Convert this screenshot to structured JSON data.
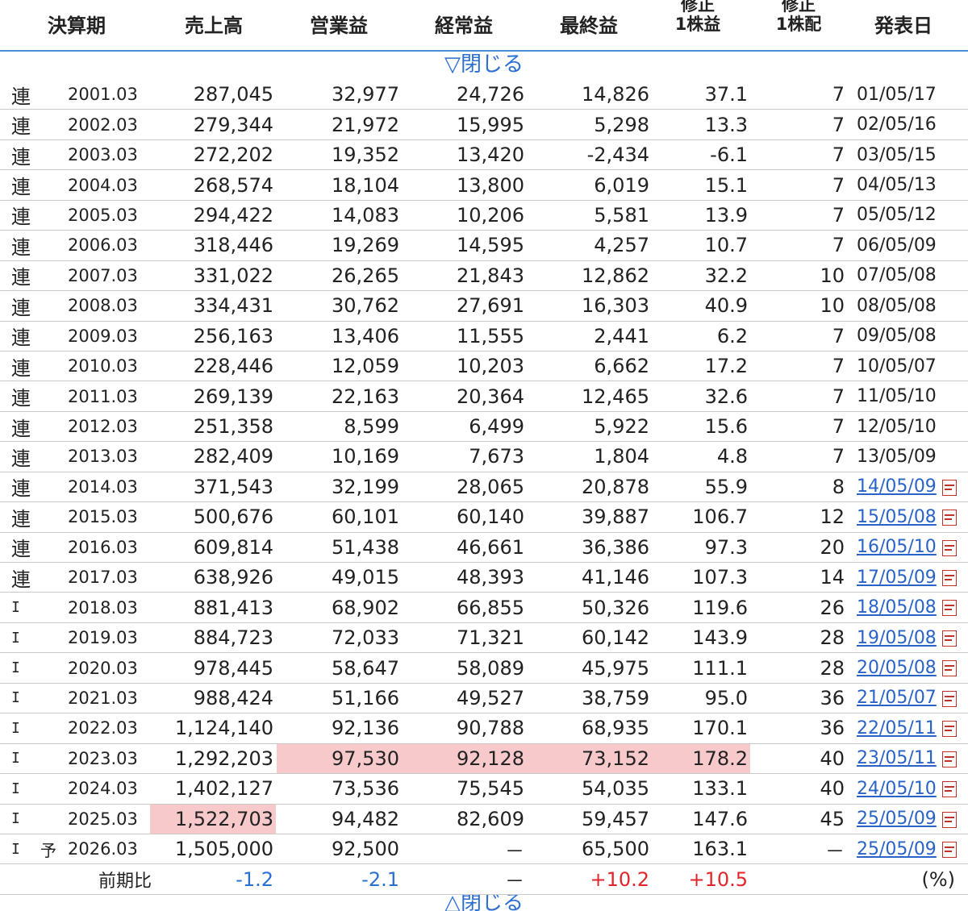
{
  "headers": {
    "period": "決算期",
    "sales": "売上高",
    "operating": "営業益",
    "ordinary": "経常益",
    "net": "最終益",
    "eps_top": "修正",
    "eps_bottom": "1株益",
    "div_top": "修正",
    "div_bottom": "1株配",
    "date": "発表日"
  },
  "toggle_top": "▽閉じる",
  "toggle_bottom": "△閉じる",
  "rows": [
    {
      "type": "連",
      "forecast": "",
      "period": "2001.03",
      "sales": "287,045",
      "operating": "32,977",
      "ordinary": "24,726",
      "net": "14,826",
      "eps": "37.1",
      "div": "7",
      "date": "01/05/17",
      "link": false,
      "hl": []
    },
    {
      "type": "連",
      "forecast": "",
      "period": "2002.03",
      "sales": "279,344",
      "operating": "21,972",
      "ordinary": "15,995",
      "net": "5,298",
      "eps": "13.3",
      "div": "7",
      "date": "02/05/16",
      "link": false,
      "hl": []
    },
    {
      "type": "連",
      "forecast": "",
      "period": "2003.03",
      "sales": "272,202",
      "operating": "19,352",
      "ordinary": "13,420",
      "net": "-2,434",
      "eps": "-6.1",
      "div": "7",
      "date": "03/05/15",
      "link": false,
      "hl": []
    },
    {
      "type": "連",
      "forecast": "",
      "period": "2004.03",
      "sales": "268,574",
      "operating": "18,104",
      "ordinary": "13,800",
      "net": "6,019",
      "eps": "15.1",
      "div": "7",
      "date": "04/05/13",
      "link": false,
      "hl": []
    },
    {
      "type": "連",
      "forecast": "",
      "period": "2005.03",
      "sales": "294,422",
      "operating": "14,083",
      "ordinary": "10,206",
      "net": "5,581",
      "eps": "13.9",
      "div": "7",
      "date": "05/05/12",
      "link": false,
      "hl": []
    },
    {
      "type": "連",
      "forecast": "",
      "period": "2006.03",
      "sales": "318,446",
      "operating": "19,269",
      "ordinary": "14,595",
      "net": "4,257",
      "eps": "10.7",
      "div": "7",
      "date": "06/05/09",
      "link": false,
      "hl": []
    },
    {
      "type": "連",
      "forecast": "",
      "period": "2007.03",
      "sales": "331,022",
      "operating": "26,265",
      "ordinary": "21,843",
      "net": "12,862",
      "eps": "32.2",
      "div": "10",
      "date": "07/05/08",
      "link": false,
      "hl": []
    },
    {
      "type": "連",
      "forecast": "",
      "period": "2008.03",
      "sales": "334,431",
      "operating": "30,762",
      "ordinary": "27,691",
      "net": "16,303",
      "eps": "40.9",
      "div": "10",
      "date": "08/05/08",
      "link": false,
      "hl": []
    },
    {
      "type": "連",
      "forecast": "",
      "period": "2009.03",
      "sales": "256,163",
      "operating": "13,406",
      "ordinary": "11,555",
      "net": "2,441",
      "eps": "6.2",
      "div": "7",
      "date": "09/05/08",
      "link": false,
      "hl": []
    },
    {
      "type": "連",
      "forecast": "",
      "period": "2010.03",
      "sales": "228,446",
      "operating": "12,059",
      "ordinary": "10,203",
      "net": "6,662",
      "eps": "17.2",
      "div": "7",
      "date": "10/05/07",
      "link": false,
      "hl": []
    },
    {
      "type": "連",
      "forecast": "",
      "period": "2011.03",
      "sales": "269,139",
      "operating": "22,163",
      "ordinary": "20,364",
      "net": "12,465",
      "eps": "32.6",
      "div": "7",
      "date": "11/05/10",
      "link": false,
      "hl": []
    },
    {
      "type": "連",
      "forecast": "",
      "period": "2012.03",
      "sales": "251,358",
      "operating": "8,599",
      "ordinary": "6,499",
      "net": "5,922",
      "eps": "15.6",
      "div": "7",
      "date": "12/05/10",
      "link": false,
      "hl": []
    },
    {
      "type": "連",
      "forecast": "",
      "period": "2013.03",
      "sales": "282,409",
      "operating": "10,169",
      "ordinary": "7,673",
      "net": "1,804",
      "eps": "4.8",
      "div": "7",
      "date": "13/05/09",
      "link": false,
      "hl": []
    },
    {
      "type": "連",
      "forecast": "",
      "period": "2014.03",
      "sales": "371,543",
      "operating": "32,199",
      "ordinary": "28,065",
      "net": "20,878",
      "eps": "55.9",
      "div": "8",
      "date": "14/05/09",
      "link": true,
      "hl": []
    },
    {
      "type": "連",
      "forecast": "",
      "period": "2015.03",
      "sales": "500,676",
      "operating": "60,101",
      "ordinary": "60,140",
      "net": "39,887",
      "eps": "106.7",
      "div": "12",
      "date": "15/05/08",
      "link": true,
      "hl": []
    },
    {
      "type": "連",
      "forecast": "",
      "period": "2016.03",
      "sales": "609,814",
      "operating": "51,438",
      "ordinary": "46,661",
      "net": "36,386",
      "eps": "97.3",
      "div": "20",
      "date": "16/05/10",
      "link": true,
      "hl": []
    },
    {
      "type": "連",
      "forecast": "",
      "period": "2017.03",
      "sales": "638,926",
      "operating": "49,015",
      "ordinary": "48,393",
      "net": "41,146",
      "eps": "107.3",
      "div": "14",
      "date": "17/05/09",
      "link": true,
      "hl": []
    },
    {
      "type": "I",
      "forecast": "",
      "period": "2018.03",
      "sales": "881,413",
      "operating": "68,902",
      "ordinary": "66,855",
      "net": "50,326",
      "eps": "119.6",
      "div": "26",
      "date": "18/05/08",
      "link": true,
      "hl": []
    },
    {
      "type": "I",
      "forecast": "",
      "period": "2019.03",
      "sales": "884,723",
      "operating": "72,033",
      "ordinary": "71,321",
      "net": "60,142",
      "eps": "143.9",
      "div": "28",
      "date": "19/05/08",
      "link": true,
      "hl": []
    },
    {
      "type": "I",
      "forecast": "",
      "period": "2020.03",
      "sales": "978,445",
      "operating": "58,647",
      "ordinary": "58,089",
      "net": "45,975",
      "eps": "111.1",
      "div": "28",
      "date": "20/05/08",
      "link": true,
      "hl": []
    },
    {
      "type": "I",
      "forecast": "",
      "period": "2021.03",
      "sales": "988,424",
      "operating": "51,166",
      "ordinary": "49,527",
      "net": "38,759",
      "eps": "95.0",
      "div": "36",
      "date": "21/05/07",
      "link": true,
      "hl": []
    },
    {
      "type": "I",
      "forecast": "",
      "period": "2022.03",
      "sales": "1,124,140",
      "operating": "92,136",
      "ordinary": "90,788",
      "net": "68,935",
      "eps": "170.1",
      "div": "36",
      "date": "22/05/11",
      "link": true,
      "hl": []
    },
    {
      "type": "I",
      "forecast": "",
      "period": "2023.03",
      "sales": "1,292,203",
      "operating": "97,530",
      "ordinary": "92,128",
      "net": "73,152",
      "eps": "178.2",
      "div": "40",
      "date": "23/05/11",
      "link": true,
      "hl": [
        "operating",
        "ordinary",
        "net",
        "eps"
      ]
    },
    {
      "type": "I",
      "forecast": "",
      "period": "2024.03",
      "sales": "1,402,127",
      "operating": "73,536",
      "ordinary": "75,545",
      "net": "54,035",
      "eps": "133.1",
      "div": "40",
      "date": "24/05/10",
      "link": true,
      "hl": []
    },
    {
      "type": "I",
      "forecast": "",
      "period": "2025.03",
      "sales": "1,522,703",
      "operating": "94,482",
      "ordinary": "82,609",
      "net": "59,457",
      "eps": "147.6",
      "div": "45",
      "date": "25/05/09",
      "link": true,
      "hl": [
        "sales"
      ]
    },
    {
      "type": "I",
      "forecast": "予",
      "period": "2026.03",
      "sales": "1,505,000",
      "operating": "92,500",
      "ordinary": "－",
      "net": "65,500",
      "eps": "163.1",
      "div": "－",
      "date": "25/05/09",
      "link": true,
      "hl": []
    }
  ],
  "yoy": {
    "label": "前期比",
    "sales": "-1.2",
    "operating": "-2.1",
    "ordinary": "－",
    "net": "+10.2",
    "eps": "+10.5",
    "unit": "(%)"
  },
  "colors": {
    "highlight": "#f7c9cb",
    "link": "#2a63c7",
    "negative": "#2a6fd1",
    "positive": "#e0262b",
    "header_rule": "#4a90d9"
  }
}
